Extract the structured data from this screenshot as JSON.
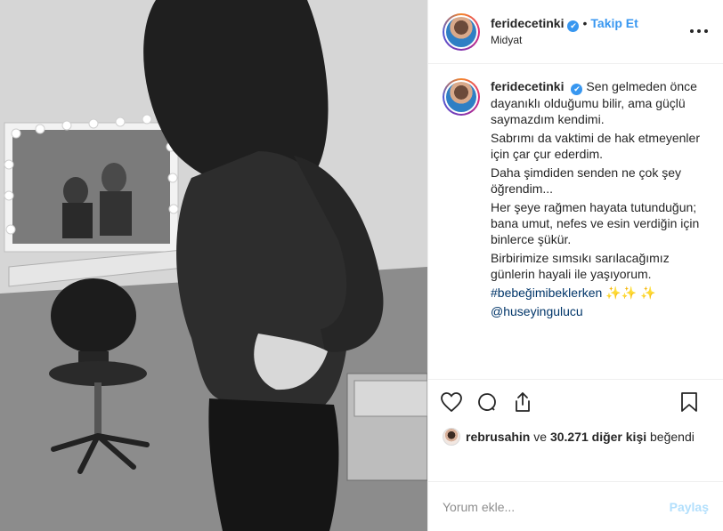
{
  "post": {
    "username": "feridecetinki",
    "verified_symbol": "✔",
    "follow_label": "Takip Et",
    "dot": "•",
    "location": "Midyat",
    "more_icon": "more-horizontal-icon"
  },
  "caption": {
    "username": "feridecetinki",
    "lines": [
      "Sen gelmeden önce dayanıklı olduğumu bilir, ama güçlü saymazdım kendimi.",
      "Sabrımı da vaktimi de hak etmeyenler için çar çur ederdim.",
      "Daha şimdiden senden ne çok şey öğrendim...",
      "Her şeye rağmen hayata tutunduğun; bana umut, nefes ve esin verdiğin için binlerce şükür.",
      "Birbirimize sımsıkı sarılacağımız günlerin hayali ile yaşıyorum."
    ],
    "hashtag": "#bebeğimibeklerken",
    "emoji_tail": "✨✨ ✨",
    "mention": "@huseyingulucu"
  },
  "likes": {
    "liker": "rebrusahin",
    "conjunction": "ve",
    "others_count": "30.271 diğer kişi",
    "suffix": "beğendi"
  },
  "comment": {
    "placeholder": "Yorum ekle...",
    "share_label": "Paylaş"
  },
  "colors": {
    "link_blue": "#3897f0",
    "share_disabled": "#b2dffc",
    "hashtag": "#003569"
  }
}
